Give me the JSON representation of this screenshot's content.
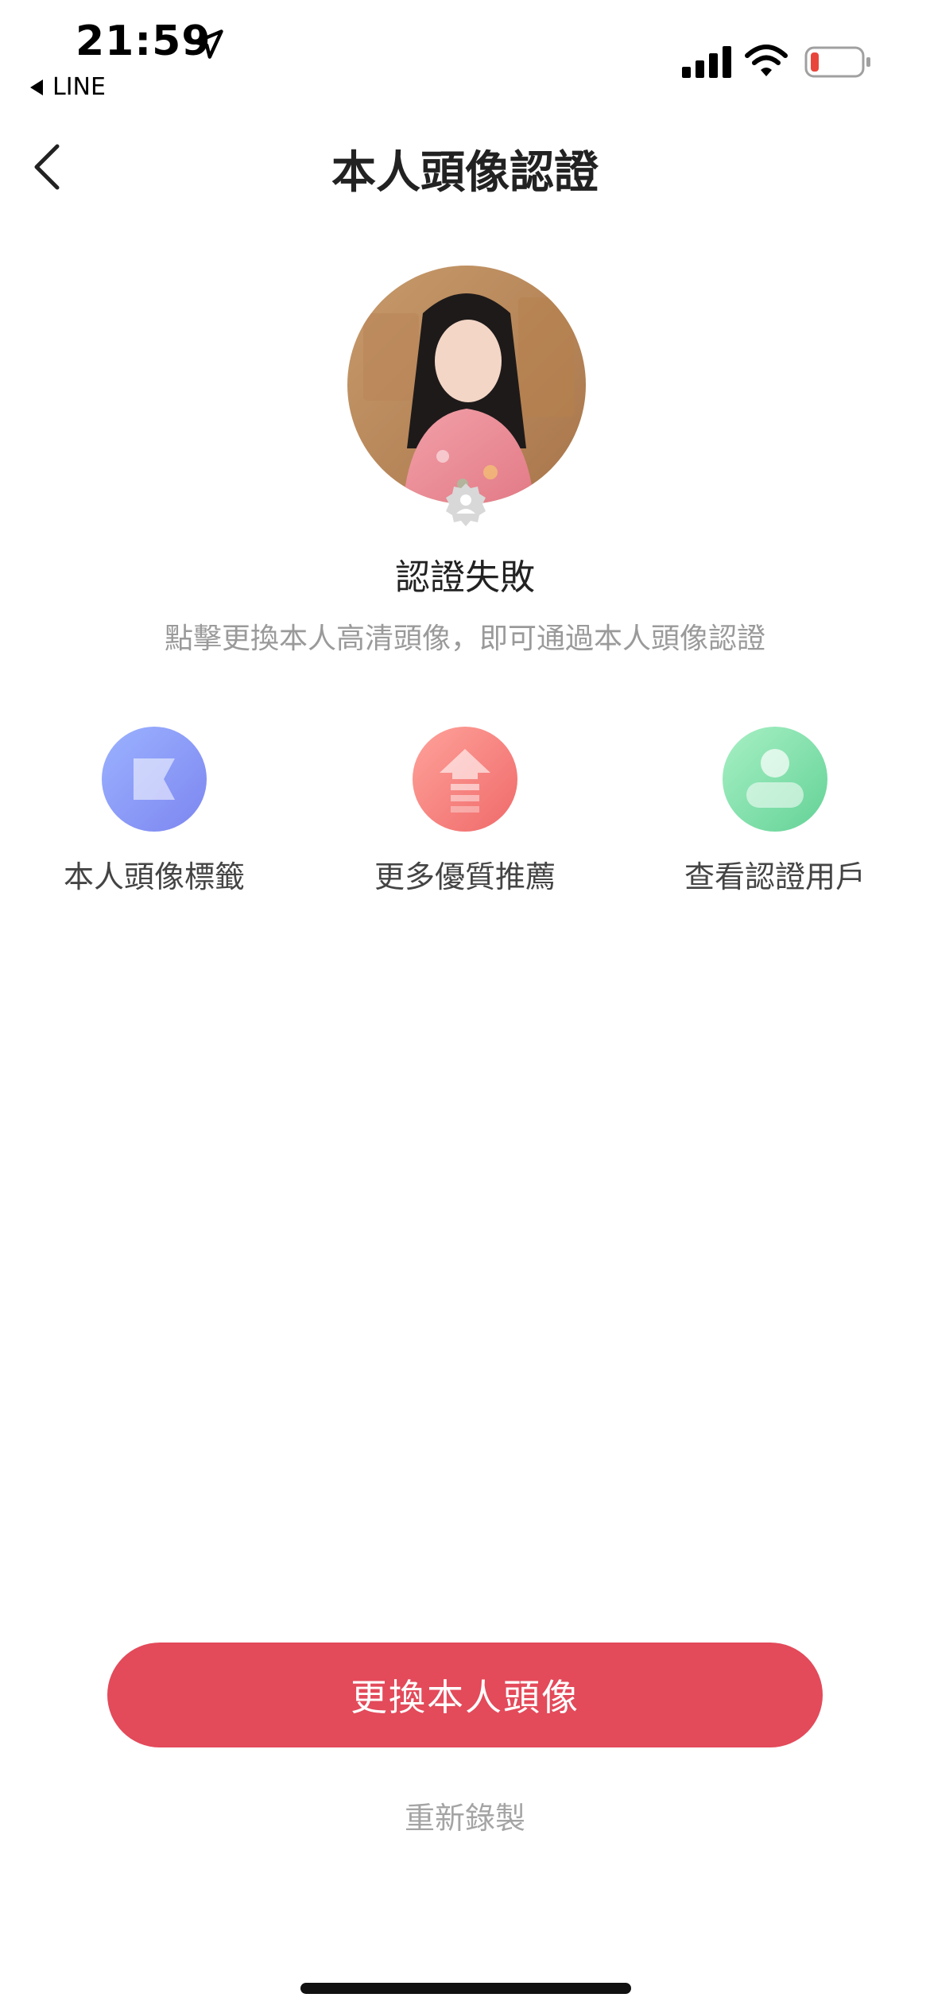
{
  "status_bar": {
    "time": "21:59",
    "back_app_label": "LINE",
    "icons": [
      "location-arrow-icon",
      "cellular-signal-icon",
      "wifi-icon",
      "battery-low-icon"
    ],
    "battery_color": "#e8463c"
  },
  "nav": {
    "back_icon": "chevron-left-icon",
    "title": "本人頭像認證"
  },
  "profile": {
    "badge_icon": "person-badge-icon",
    "status_title": "認證失敗",
    "status_desc": "點擊更換本人高清頭像，即可通過本人頭像認證"
  },
  "features": [
    {
      "label": "本人頭像標籤",
      "icon": "tag-icon",
      "color": "#8a98f6"
    },
    {
      "label": "更多優質推薦",
      "icon": "up-arrow-icon",
      "color": "#f27c78"
    },
    {
      "label": "查看認證用戶",
      "icon": "person-icon",
      "color": "#7ddca6"
    }
  ],
  "actions": {
    "primary_label": "更換本人頭像",
    "primary_color": "#e34a5a",
    "secondary_label": "重新錄製"
  }
}
